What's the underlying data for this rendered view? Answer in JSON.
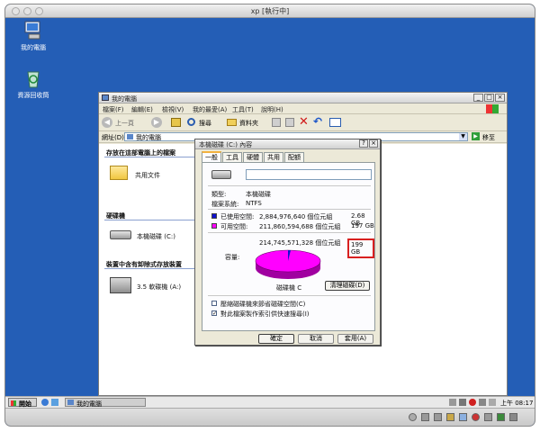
{
  "host": {
    "title": "xp [執行中]"
  },
  "desktop": {
    "icons": [
      {
        "label": "我的電腦"
      },
      {
        "label": "資源回收筒"
      }
    ]
  },
  "explorer": {
    "title": "我的電腦",
    "menu": [
      "檔案(F)",
      "編輯(E)",
      "檢視(V)",
      "我的最愛(A)",
      "工具(T)",
      "說明(H)"
    ],
    "toolbar": {
      "back": "上一頁",
      "search": "搜尋",
      "folders": "資料夾"
    },
    "address": {
      "label": "網址(D)",
      "value": "我的電腦",
      "go": "移至"
    },
    "left_pane": {
      "section1": "存放在這部電腦上的檔案",
      "shared_docs": "共用文件",
      "section2": "硬碟機",
      "local_disk": "本機磁碟 (C:)",
      "section3": "裝置中含有卸除式存放裝置",
      "floppy": "3.5 軟碟機 (A:)"
    }
  },
  "dialog": {
    "title": "本機磁碟 (C:) 內容",
    "tabs": [
      "一般",
      "工具",
      "硬體",
      "共用",
      "配額"
    ],
    "name_value": "",
    "type_label": "類型:",
    "type_value": "本機磁碟",
    "fs_label": "檔案系統:",
    "fs_value": "NTFS",
    "used_label": "已使用空間:",
    "used_bytes": "2,884,976,640 個位元組",
    "used_gb": "2.68 GB",
    "free_label": "可用空間:",
    "free_bytes": "211,860,594,688 個位元組",
    "free_gb": "197 GB",
    "capacity_label": "容量:",
    "capacity_bytes": "214,745,571,328 個位元組",
    "capacity_gb": "199 GB",
    "drive_label": "磁碟機 C",
    "cleanup_button": "清理磁碟(D)",
    "compress_option": "壓縮磁碟機來節省磁碟空間(C)",
    "index_option": "對此檔案製作索引供快速搜尋(I)",
    "index_checked": true,
    "ok": "確定",
    "cancel": "取消",
    "apply": "套用(A)",
    "used_fraction": 0.0134,
    "colors": {
      "used": "#1010d0",
      "free": "#ff00ff"
    }
  },
  "taskbar": {
    "start": "開始",
    "task": "我的電腦",
    "clock": "上午 08:17"
  }
}
